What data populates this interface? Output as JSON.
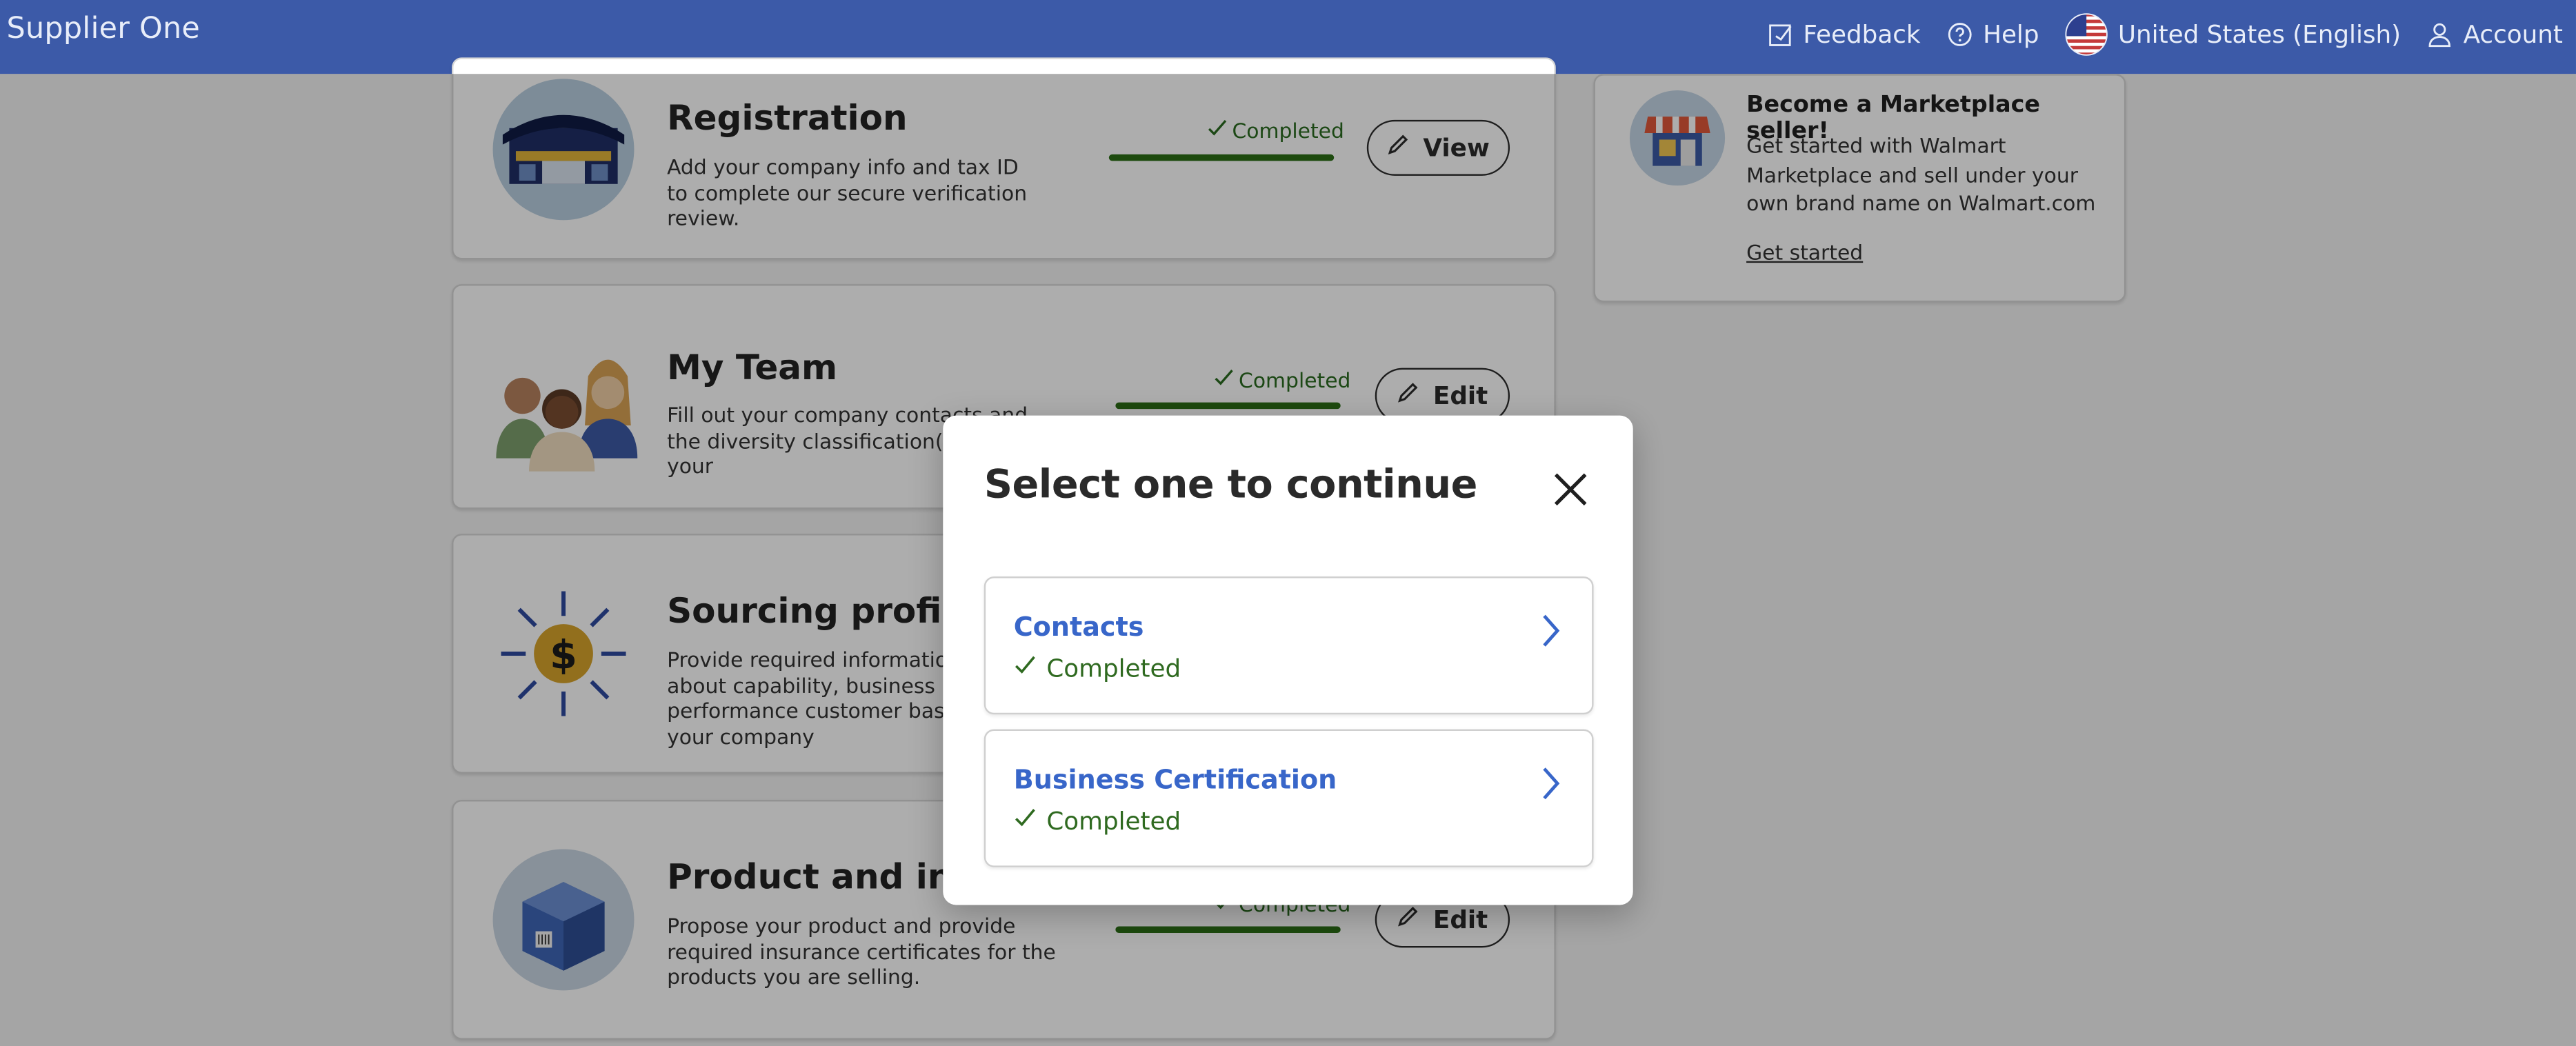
{
  "header": {
    "brand": "Supplier One",
    "nav": [
      {
        "label": "Feedback",
        "icon": "feedback-icon"
      },
      {
        "label": "Help",
        "icon": "help-icon"
      },
      {
        "label": "United States (English)",
        "icon": "us-flag-icon"
      },
      {
        "label": "Account",
        "icon": "account-icon"
      }
    ]
  },
  "cards": [
    {
      "title": "Registration",
      "desc": "Add your company info and tax ID to complete our secure verification review.",
      "status": "Completed",
      "action": "View",
      "progress": 1.0
    },
    {
      "title": "My Team",
      "desc": "Fill out your company contacts and the diversity classification(s) of your",
      "status": "Completed",
      "action": "Edit",
      "progress": 1.0
    },
    {
      "title": "Sourcing profile",
      "desc": "Provide required information about capability, business performance customer base of your company",
      "status": "",
      "action": "",
      "progress": null
    },
    {
      "title": "Product and insurance",
      "desc": "Propose your product and provide required insurance certificates for the products you are selling.",
      "status": "Completed",
      "action": "Edit",
      "progress": 1.0
    }
  ],
  "sidebar": {
    "heading": "Become a Marketplace seller!",
    "body": "Get started with Walmart Marketplace and sell under your own brand name on Walmart.com",
    "link": "Get started"
  },
  "modal": {
    "title": "Select one to continue",
    "options": [
      {
        "label": "Contacts",
        "status": "Completed"
      },
      {
        "label": "Business Certification",
        "status": "Completed"
      }
    ]
  },
  "colors": {
    "header": "#3c5aa8",
    "accent": "#3866c9",
    "success": "#2b6e16"
  }
}
